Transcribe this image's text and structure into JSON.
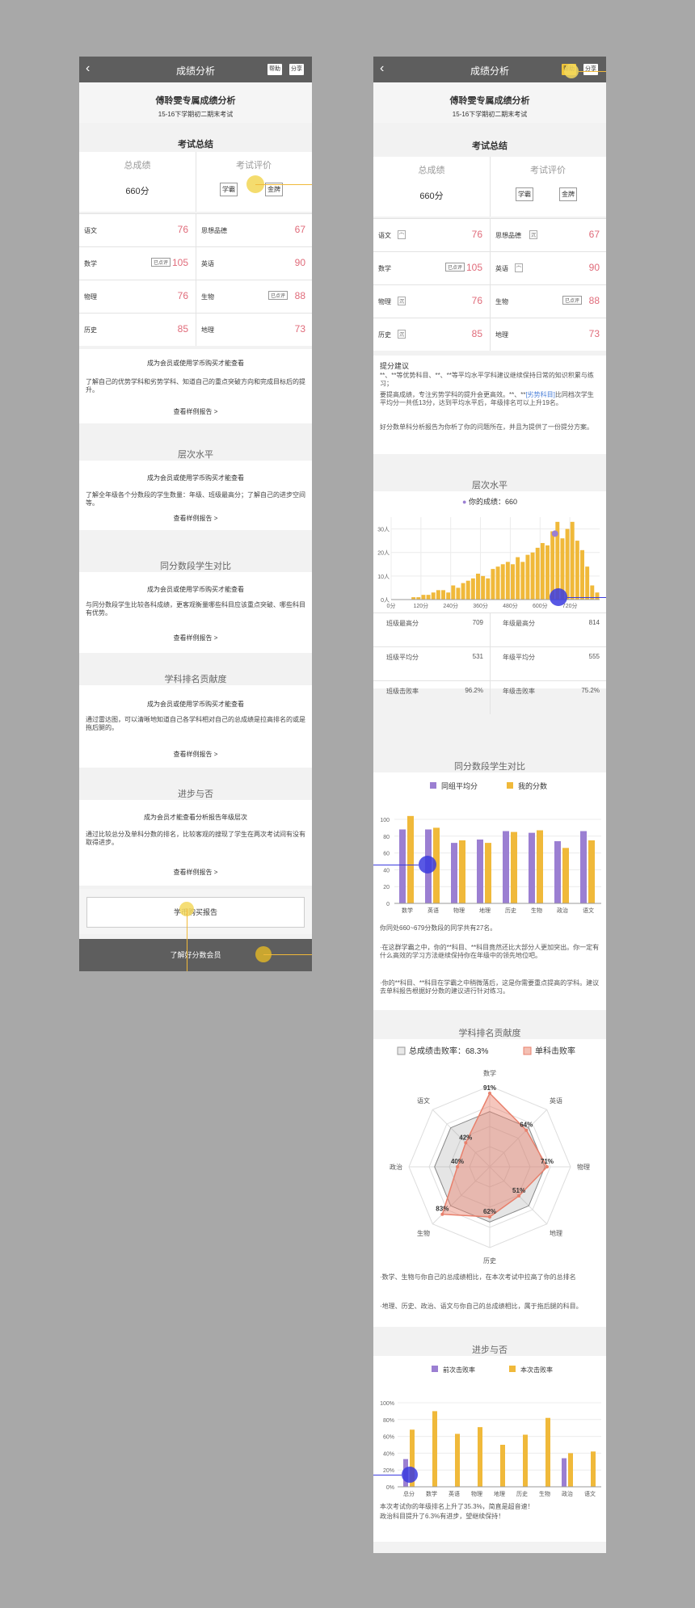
{
  "nav": {
    "title": "成绩分析",
    "back": "‹",
    "help": "帮助",
    "share": "分享"
  },
  "header": {
    "name_title": "傅聆雯专属成绩分析",
    "exam": "15-16下学期初二期末考试"
  },
  "summary": {
    "section": "考试总结",
    "total_label": "总成绩",
    "total_value": "660分",
    "eval_label": "考试评价",
    "badge1": "学霸",
    "badge2": "金牌"
  },
  "subjects": [
    {
      "name": "语文",
      "score": "76",
      "mini": "宀"
    },
    {
      "name": "思想品德",
      "score": "67",
      "mini": "沉"
    },
    {
      "name": "数学",
      "score": "105",
      "tag": "已点评"
    },
    {
      "name": "英语",
      "score": "90",
      "mini": "宀"
    },
    {
      "name": "物理",
      "score": "76",
      "mini": "沉"
    },
    {
      "name": "生物",
      "score": "88",
      "tag": "已点评"
    },
    {
      "name": "历史",
      "score": "85",
      "mini": "沉"
    },
    {
      "name": "地理",
      "score": "73"
    }
  ],
  "locked": {
    "title": "成为会员或使用学币购买才能查看",
    "title_member": "成为会员才能查看分析报告年级层次",
    "sample": "查看样例报告 >",
    "summary_desc": "了解自己的优势学科和劣势学科、知道自己的重点突破方向和完成目标后的提升。",
    "level_desc": "了解全年级各个分数段的学生数量：年级、班级最高分；了解自己的进步空间等。",
    "peer_desc": "与同分数段学生比较各科成绩，更客观衡量哪些科目应该重点突破、哪些科目有优势。",
    "rank_desc": "通过雷达图，可以清晰地知道自己各学科相对自己的总成绩是拉高排名的或是拖后腿的。",
    "progress_desc": "通过比较总分及单科分数的排名，比较客观的搜现了学生在两次考试间有没有取得进步。",
    "buy": "学币购买报告",
    "member": "了解好分数会员"
  },
  "sections": {
    "level": "层次水平",
    "peer": "同分数段学生对比",
    "rank": "学科排名贡献度",
    "progress": "进步与否"
  },
  "advice": {
    "title": "提分建议",
    "p1": "**、**等优势科目、**、**等平均水平学科建议继续保持日常的知识积累与练习；",
    "p2a": "要提高成绩，专注劣势学科的提升会更高效。**、**",
    "p2link": "[劣势科目]",
    "p2b": "比同档次学生平均分一共低13分，达到平均水平后，年级排名可以上升19名。",
    "p3": "好分数单科分析报告为你析了你的问题所在，并且为提供了一份提分方案。"
  },
  "level": {
    "your_score": "你的成绩：660",
    "stats": [
      {
        "label": "班级最高分",
        "value": "709"
      },
      {
        "label": "年级最高分",
        "value": "814"
      },
      {
        "label": "班级平均分",
        "value": "531"
      },
      {
        "label": "年级平均分",
        "value": "555"
      },
      {
        "label": "班级击败率",
        "value": "96.2%"
      },
      {
        "label": "年级击败率",
        "value": "75.2%"
      }
    ]
  },
  "peer_text": {
    "t1": "你同处660~679分数段的同学共有27名。",
    "t2": "·在这群学霸之中，你的**科目、**科目竟然还比大部分人更加突出。你一定有什么高效的学习方法继续保持你在年级中的领先地位吧。",
    "t3": "·你的**科目、**科目在学霸之中稍微落后，这是你需要重点提高的学科。建议去单科报告根据好分数的建议进行针对练习。"
  },
  "rank_text": {
    "legend1": "总成绩击败率：68.3%",
    "legend2": "单科击败率",
    "t1": "·数学、生物与你自己的总成绩相比，在本次考试中拉高了你的总排名",
    "t2": "·地理、历史、政治、语文与你自己的总成绩相比，属于拖后腿的科目。"
  },
  "progress_text": {
    "t1": "本次考试你的年级排名上升了35.3%，简直是超音速！",
    "t2": "政治科目提升了6.3%有进步，望继续保持！"
  },
  "colors": {
    "nav": "#5e5e5e",
    "accent": "#f0b93a",
    "purple": "#9b7fd2",
    "red": "#e06b7a",
    "marker": "#3b3bdf",
    "radar": "#e8806c"
  },
  "chart_data": [
    {
      "type": "bar",
      "title": "层次水平",
      "x_tick_labels": [
        "0分",
        "120分",
        "240分",
        "360分",
        "480分",
        "600分",
        "720分"
      ],
      "y_tick_labels": [
        "0人",
        "10人",
        "20人",
        "30人"
      ],
      "ylim": [
        0,
        35
      ],
      "x_start": 0,
      "x_step": 20,
      "values": [
        0,
        0,
        0,
        0,
        1,
        1,
        2,
        2,
        3,
        4,
        4,
        3,
        6,
        5,
        7,
        8,
        9,
        11,
        10,
        9,
        13,
        14,
        15,
        16,
        15,
        18,
        16,
        19,
        20,
        22,
        24,
        23,
        29,
        33,
        26,
        30,
        33,
        25,
        21,
        14,
        6,
        3
      ],
      "marker": {
        "label": "你的成绩：660",
        "x": 660,
        "y": 28
      }
    },
    {
      "type": "bar",
      "title": "同分数段学生对比",
      "categories": [
        "数学",
        "英语",
        "物理",
        "地理",
        "历史",
        "生物",
        "政治",
        "语文"
      ],
      "series": [
        {
          "name": "同组平均分",
          "values": [
            88,
            88,
            72,
            76,
            86,
            84,
            74,
            86
          ]
        },
        {
          "name": "我的分数",
          "values": [
            104,
            90,
            75,
            72,
            85,
            87,
            66,
            75
          ]
        }
      ],
      "ylim": [
        0,
        100
      ],
      "y_ticks": [
        0,
        20,
        40,
        60,
        80,
        100
      ]
    },
    {
      "type": "radar",
      "title": "学科排名贡献度",
      "axes": [
        "数学",
        "英语",
        "物理",
        "地理",
        "历史",
        "生物",
        "政治",
        "语文"
      ],
      "series": [
        {
          "name": "总成绩击败率：68.3%",
          "values": [
            68.3,
            68.3,
            68.3,
            68.3,
            68.3,
            68.3,
            68.3,
            68.3
          ]
        },
        {
          "name": "单科击败率",
          "values": [
            91,
            64,
            71,
            51,
            62,
            83,
            40,
            42
          ]
        }
      ]
    },
    {
      "type": "bar",
      "title": "进步与否",
      "categories": [
        "总分",
        "数学",
        "英语",
        "物理",
        "地理",
        "历史",
        "生物",
        "政治",
        "语文"
      ],
      "series": [
        {
          "name": "前次击败率",
          "values": [
            33,
            0,
            0,
            0,
            0,
            0,
            0,
            34,
            0
          ]
        },
        {
          "name": "本次击败率",
          "values": [
            68,
            90,
            63,
            71,
            50,
            62,
            82,
            40,
            42
          ]
        }
      ],
      "ylim": [
        0,
        100
      ],
      "y_tick_labels": [
        "0%",
        "20%",
        "40%",
        "60%",
        "80%",
        "100%"
      ]
    }
  ]
}
